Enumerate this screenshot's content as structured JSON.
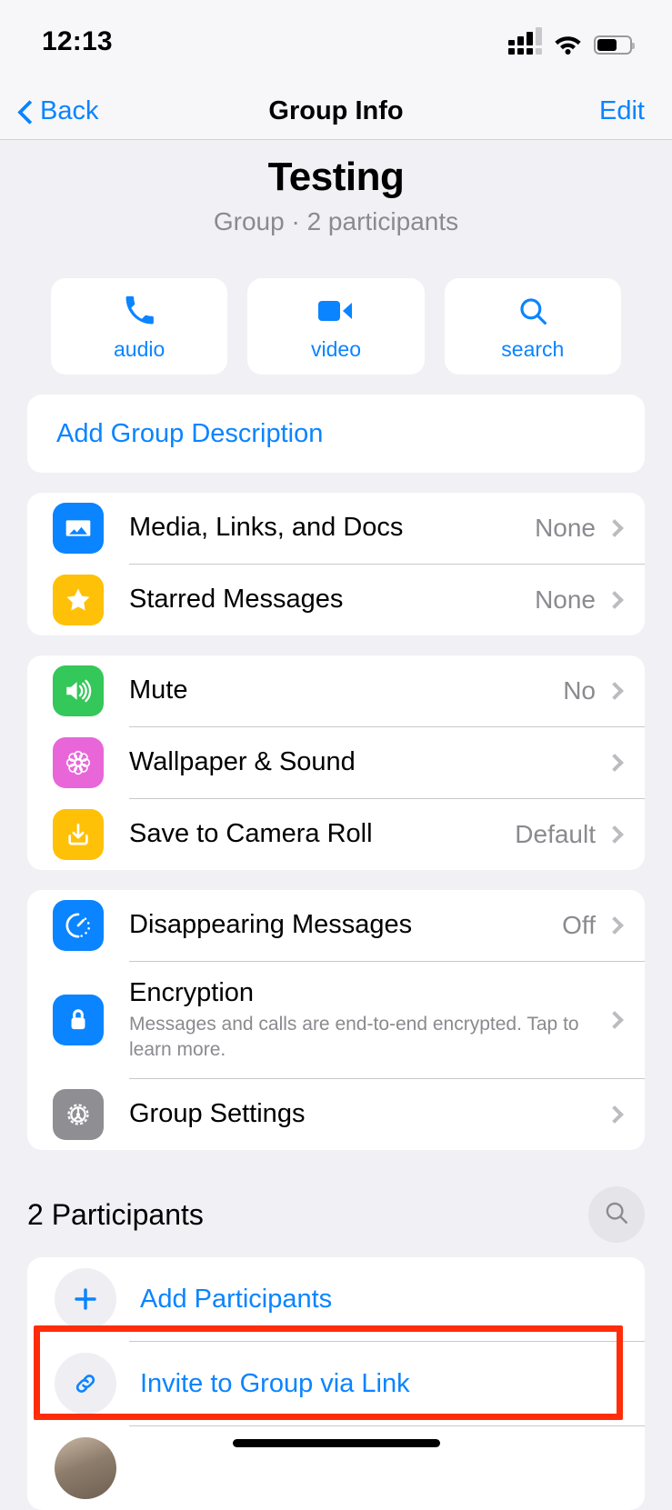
{
  "status_bar": {
    "time": "12:13",
    "signal_icon": "cellular-signal-icon",
    "wifi_icon": "wifi-icon",
    "battery_icon": "battery-icon"
  },
  "nav": {
    "back_label": "Back",
    "title": "Group Info",
    "edit_label": "Edit"
  },
  "group": {
    "name": "Testing",
    "subtitle": "Group · 2 participants"
  },
  "actions": [
    {
      "label": "audio",
      "icon": "phone-icon"
    },
    {
      "label": "video",
      "icon": "video-camera-icon"
    },
    {
      "label": "search",
      "icon": "search-icon"
    }
  ],
  "description": {
    "label": "Add Group Description"
  },
  "sections": [
    {
      "rows": [
        {
          "title": "Media, Links, and Docs",
          "value": "None",
          "icon": "photo-icon",
          "icon_color": "#0a84ff"
        },
        {
          "title": "Starred Messages",
          "value": "None",
          "icon": "star-icon",
          "icon_color": "#ffc107"
        }
      ]
    },
    {
      "rows": [
        {
          "title": "Mute",
          "value": "No",
          "icon": "speaker-icon",
          "icon_color": "#34c759"
        },
        {
          "title": "Wallpaper & Sound",
          "value": "",
          "icon": "flower-icon",
          "icon_color": "#e866d8"
        },
        {
          "title": "Save to Camera Roll",
          "value": "Default",
          "icon": "save-download-icon",
          "icon_color": "#ffc107"
        }
      ]
    },
    {
      "rows": [
        {
          "title": "Disappearing Messages",
          "value": "Off",
          "icon": "timer-icon",
          "icon_color": "#0a84ff"
        },
        {
          "title": "Encryption",
          "value": "",
          "subtitle": "Messages and calls are end-to-end encrypted. Tap to learn more.",
          "icon": "lock-icon",
          "icon_color": "#0a84ff"
        },
        {
          "title": "Group Settings",
          "value": "",
          "icon": "gear-icon",
          "icon_color": "#8e8e93"
        }
      ]
    }
  ],
  "participants": {
    "heading": "2 Participants",
    "search_icon": "search-icon",
    "add_label": "Add Participants",
    "add_icon": "plus-icon",
    "invite_label": "Invite to Group via Link",
    "invite_icon": "link-icon"
  },
  "colors": {
    "accent": "#0a84ff",
    "background": "#f0f0f5",
    "card": "#ffffff",
    "secondary_text": "#8a8a8f",
    "highlight": "#ff2d0a"
  }
}
